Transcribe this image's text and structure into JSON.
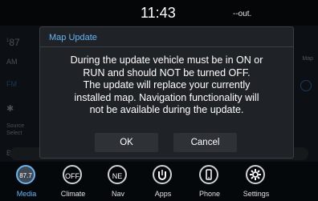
{
  "status_bar": {
    "time": "11:43",
    "outside_temp": "--out."
  },
  "background": {
    "frequency": "87",
    "frequency_sup": "1",
    "am_label": "AM",
    "fm_label": "FM",
    "source_select": "Source\nSelect",
    "b_label": "B",
    "map_label": "Map"
  },
  "dialog": {
    "title": "Map Update",
    "message_lines": [
      "During the update vehicle must be in ON or",
      "RUN and should NOT be turned OFF.",
      "The update will replace your currently",
      "installed map. Navigation functionality will",
      "not be available during the update."
    ],
    "ok_label": "OK",
    "cancel_label": "Cancel"
  },
  "nav": {
    "items": [
      {
        "label": "Media",
        "icon_text": "87.7",
        "icon": "media-icon",
        "active": true
      },
      {
        "label": "Climate",
        "icon_text": "OFF",
        "icon": "climate-icon",
        "active": false
      },
      {
        "label": "Nav",
        "icon_text": "NE",
        "icon": "compass-icon",
        "active": false
      },
      {
        "label": "Apps",
        "icon_text": "",
        "icon": "apps-icon",
        "active": false
      },
      {
        "label": "Phone",
        "icon_text": "",
        "icon": "phone-icon",
        "active": false
      },
      {
        "label": "Settings",
        "icon_text": "",
        "icon": "gear-icon",
        "active": false
      }
    ]
  },
  "colors": {
    "accent": "#67b4f1",
    "dialog_bg": "#1f2327",
    "button_bg": "#2e3236"
  }
}
